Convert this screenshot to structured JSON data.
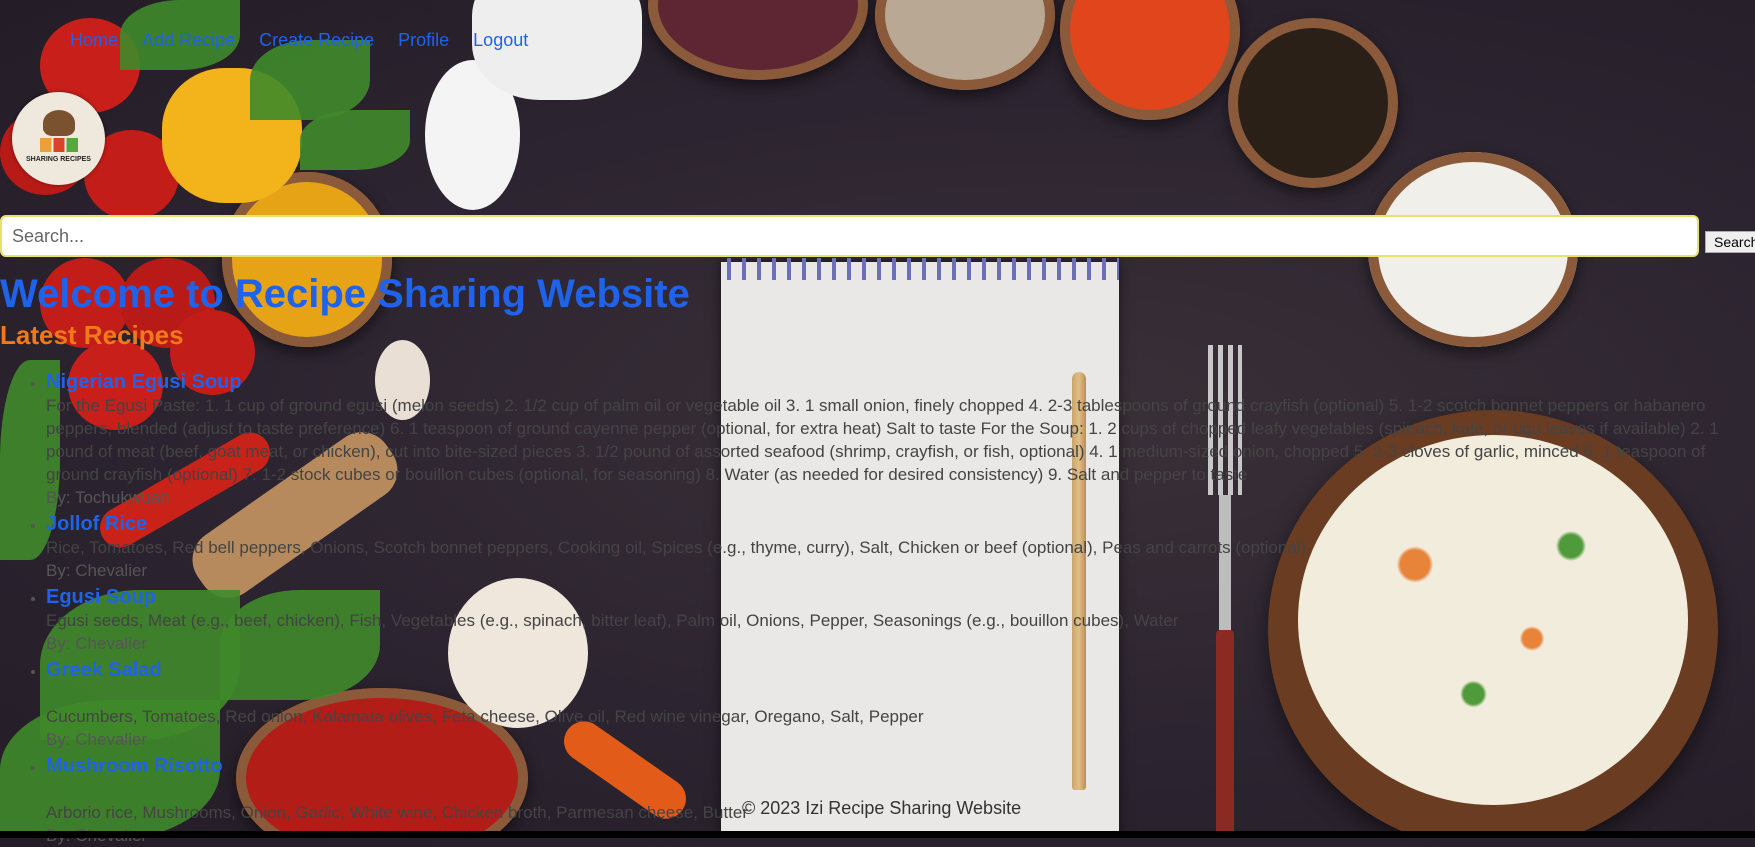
{
  "nav": {
    "items": [
      "Home",
      "Add Recipe",
      "Create Recipe",
      "Profile",
      "Logout"
    ]
  },
  "logo": {
    "text": "SHARING RECIPES"
  },
  "search": {
    "placeholder": "Search...",
    "button_label": "Search"
  },
  "heading": "Welcome to Recipe Sharing Website",
  "subheading": "Latest Recipes",
  "recipes": [
    {
      "title": "Nigerian Egusi Soup",
      "description": "For the Egusi Paste: 1. 1 cup of ground egusi (melon seeds) 2. 1/2 cup of palm oil or vegetable oil 3. 1 small onion, finely chopped 4. 2-3 tablespoons of ground crayfish (optional) 5. 1-2 scotch bonnet peppers or habanero peppers, blended (adjust to taste preference) 6. 1 teaspoon of ground cayenne pepper (optional, for extra heat) Salt to taste For the Soup: 1. 2 cups of chopped leafy vegetables (spinach, kale, or ugu leaves if available) 2. 1 pound of meat (beef, goat meat, or chicken), cut into bite-sized pieces 3. 1/2 pound of assorted seafood (shrimp, crayfish, or fish, optional) 4. 1 medium-sized onion, chopped 5. 2-3 cloves of garlic, minced 6. 1 teaspoon of ground crayfish (optional) 7. 1-2 stock cubes or bouillon cubes (optional, for seasoning) 8. Water (as needed for desired consistency) 9. Salt and pepper to taste",
      "author": "By: Tochukwuan",
      "spacer": false
    },
    {
      "title": "Jollof Rice",
      "description": "Rice, Tomatoes, Red bell peppers, Onions, Scotch bonnet peppers, Cooking oil, Spices (e.g., thyme, curry), Salt, Chicken or beef (optional), Peas and carrots (optional)",
      "author": "By: Chevalier",
      "spacer": false
    },
    {
      "title": "Egusi Soup",
      "description": "Egusi seeds, Meat (e.g., beef, chicken), Fish, Vegetables (e.g., spinach, bitter leaf), Palm oil, Onions, Pepper, Seasonings (e.g., bouillon cubes), Water",
      "author": "By: Chevalier",
      "spacer": false
    },
    {
      "title": "Greek Salad",
      "description": "Cucumbers, Tomatoes, Red onion, Kalamata olives, Feta cheese, Olive oil, Red wine vinegar, Oregano, Salt, Pepper",
      "author": "By: Chevalier",
      "spacer": true
    },
    {
      "title": "Mushroom Risotto",
      "description": "Arborio rice, Mushrooms, Onion, Garlic, White wine, Chicken broth, Parmesan cheese, Butter",
      "author": "By: Chevalier",
      "spacer": true
    }
  ],
  "footer": "© 2023 Izi Recipe Sharing Website",
  "colors": {
    "link": "#1e63e9",
    "subheading": "#f07a1a",
    "search_border": "#e7e36a"
  }
}
